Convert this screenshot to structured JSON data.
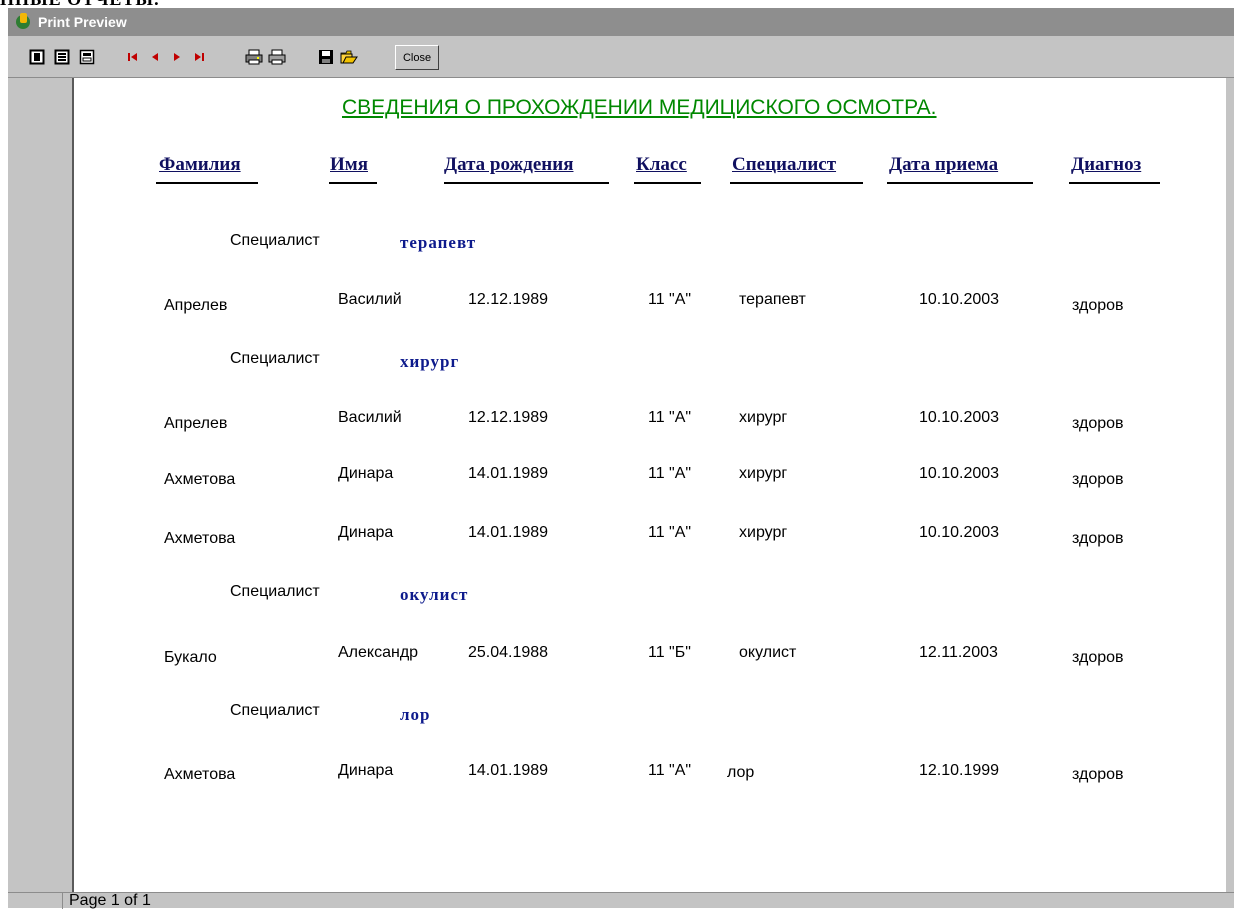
{
  "window": {
    "title": "Print Preview"
  },
  "toolbar": {
    "icons": [
      "page-view-icon",
      "two-page-icon",
      "fit-page-icon",
      "first-page-icon",
      "prev-page-icon",
      "next-page-icon",
      "last-page-icon",
      "print-setup-icon",
      "print-icon",
      "save-icon",
      "open-icon"
    ],
    "close_label": "Close"
  },
  "report": {
    "title": "СВЕДЕНИЯ О ПРОХОЖДЕНИИ МЕДИЦИСКОГО ОСМОТРА.",
    "columns": [
      "Фамилия",
      "Имя",
      "Дата рождения",
      "Класс",
      "Специалист",
      "Дата приема",
      "Диагноз"
    ],
    "group_label": "Специалист",
    "groups": [
      {
        "name": "терапевт",
        "rows": [
          [
            "Апрелев",
            "Василий",
            "12.12.1989",
            "11 \"А\"",
            "терапевт",
            "10.10.2003",
            "здоров"
          ]
        ]
      },
      {
        "name": "хирург",
        "rows": [
          [
            "Апрелев",
            "Василий",
            "12.12.1989",
            "11 \"А\"",
            "хирург",
            "10.10.2003",
            "здоров"
          ],
          [
            "Ахметова",
            "Динара",
            "14.01.1989",
            "11 \"А\"",
            "хирург",
            "10.10.2003",
            "здоров"
          ],
          [
            "Ахметова",
            "Динара",
            "14.01.1989",
            "11 \"А\"",
            "хирург",
            "10.10.2003",
            "здоров"
          ]
        ]
      },
      {
        "name": "окулист",
        "rows": [
          [
            "Букало",
            "Александр",
            "25.04.1988",
            "11 \"Б\"",
            "окулист",
            "12.11.2003",
            "здоров"
          ]
        ]
      },
      {
        "name": "лор",
        "rows": [
          [
            "Ахметова",
            "Динара",
            "14.01.1989",
            "11 \"А\"",
            "лор",
            "12.10.1999",
            "здоров"
          ]
        ]
      }
    ]
  },
  "status": {
    "page": "Page 1 of 1"
  },
  "colors": {
    "title_green": "#008800",
    "header_navy": "#101060",
    "group_blue": "#0d1a8c"
  }
}
